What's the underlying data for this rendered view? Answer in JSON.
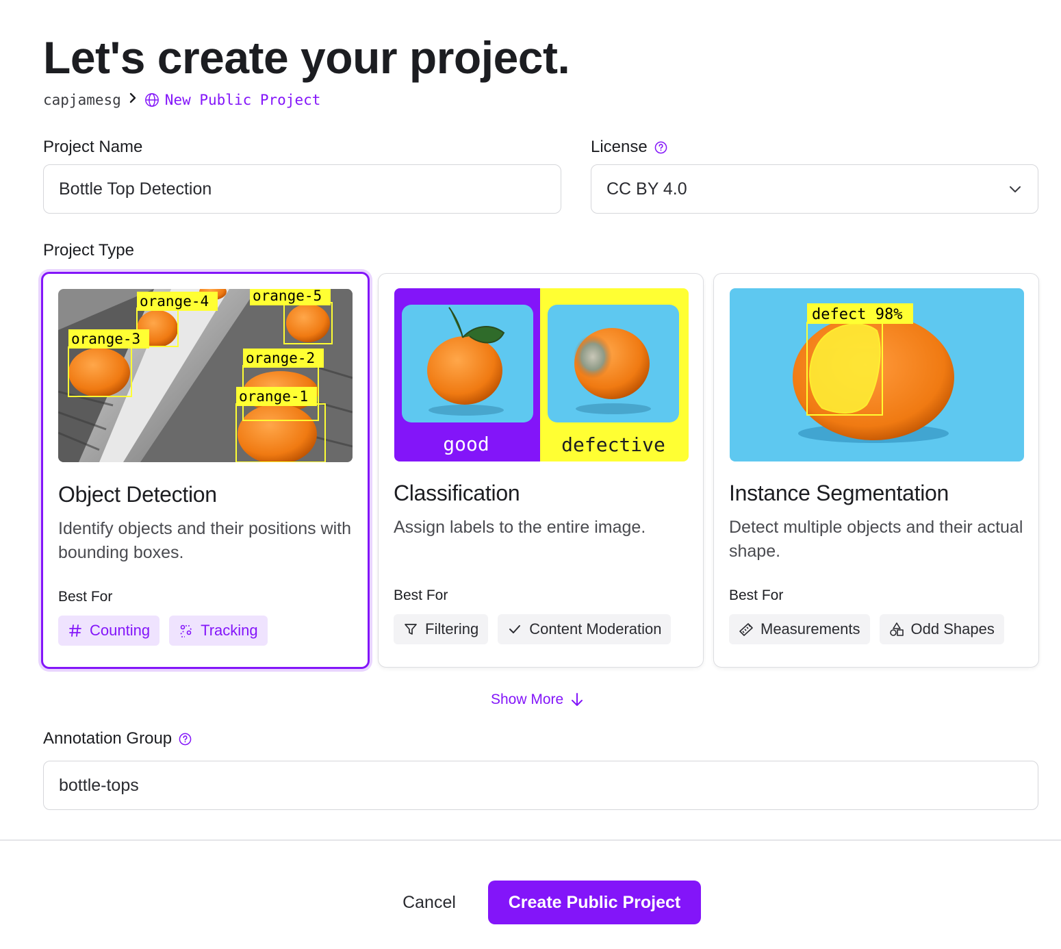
{
  "header": {
    "title": "Let's create your project.",
    "breadcrumb": {
      "owner": "capjamesg",
      "project": "New Public Project"
    }
  },
  "form": {
    "project_name": {
      "label": "Project Name",
      "value": "Bottle Top Detection"
    },
    "license": {
      "label": "License",
      "value": "CC BY 4.0"
    },
    "project_type": {
      "label": "Project Type"
    },
    "annotation_group": {
      "label": "Annotation Group",
      "value": "bottle-tops"
    }
  },
  "project_types": [
    {
      "title": "Object Detection",
      "description": "Identify objects and their positions with bounding boxes.",
      "best_for_label": "Best For",
      "tags": [
        {
          "label": "Counting",
          "icon": "hash-icon"
        },
        {
          "label": "Tracking",
          "icon": "tracking-icon"
        }
      ],
      "image_labels": [
        "orange-4",
        "orange-5",
        "orange-3",
        "orange-2",
        "orange-1"
      ],
      "selected": true
    },
    {
      "title": "Classification",
      "description": "Assign labels to the entire image.",
      "best_for_label": "Best For",
      "tags": [
        {
          "label": "Filtering",
          "icon": "filter-icon"
        },
        {
          "label": "Content Moderation",
          "icon": "check-icon"
        }
      ],
      "image_labels": [
        "good",
        "defective"
      ],
      "selected": false
    },
    {
      "title": "Instance Segmentation",
      "description": "Detect multiple objects and their actual shape.",
      "best_for_label": "Best For",
      "tags": [
        {
          "label": "Measurements",
          "icon": "ruler-icon"
        },
        {
          "label": "Odd Shapes",
          "icon": "shapes-icon"
        }
      ],
      "image_labels": [
        "defect 98%"
      ],
      "selected": false
    }
  ],
  "show_more": "Show More",
  "footer": {
    "cancel_label": "Cancel",
    "create_label": "Create Public Project"
  },
  "colors": {
    "accent": "#8315f9",
    "tag_purple_bg": "#efe3fe",
    "box_yellow": "#ffff00",
    "sky_blue": "#5ec8f0"
  }
}
